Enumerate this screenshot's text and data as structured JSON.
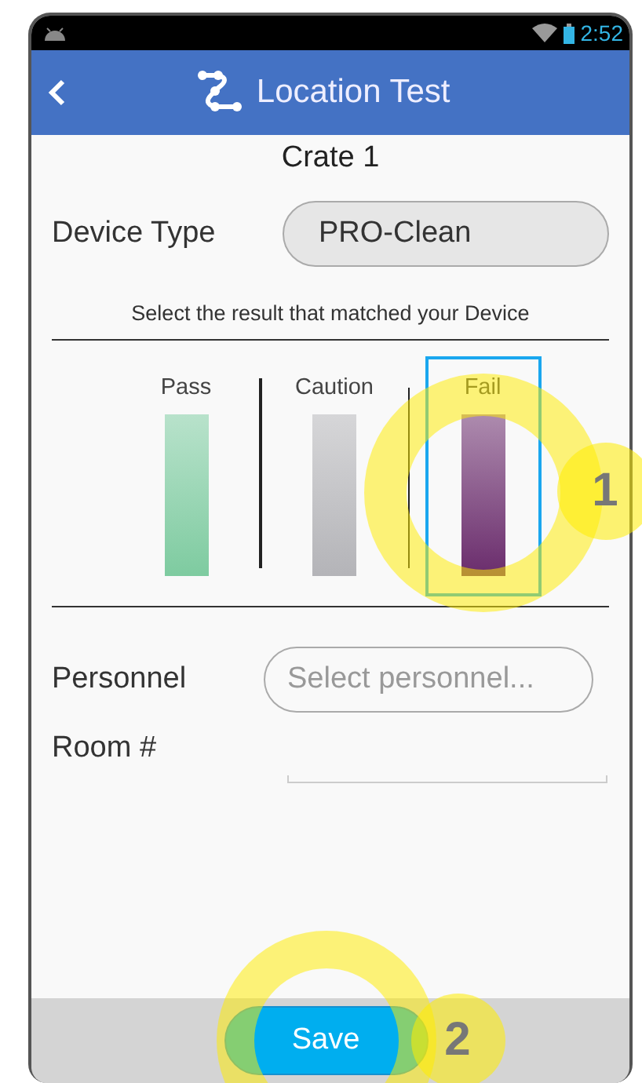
{
  "status_bar": {
    "time": "2:52"
  },
  "header": {
    "title": "Location Test"
  },
  "crate": "Crate 1",
  "device_type": {
    "label": "Device Type",
    "value": "PRO-Clean"
  },
  "instruction": "Select the result that matched your Device",
  "results": [
    {
      "label": "Pass",
      "selected": false,
      "color": "#7ecba0"
    },
    {
      "label": "Caution",
      "selected": false,
      "color": "#b4b4b8"
    },
    {
      "label": "Fail",
      "selected": true,
      "color": "#6a2c6c",
      "annotation": "1"
    }
  ],
  "personnel": {
    "label": "Personnel",
    "placeholder": "Select personnel..."
  },
  "room": {
    "label": "Room #"
  },
  "save": {
    "label": "Save",
    "annotation": "2"
  }
}
